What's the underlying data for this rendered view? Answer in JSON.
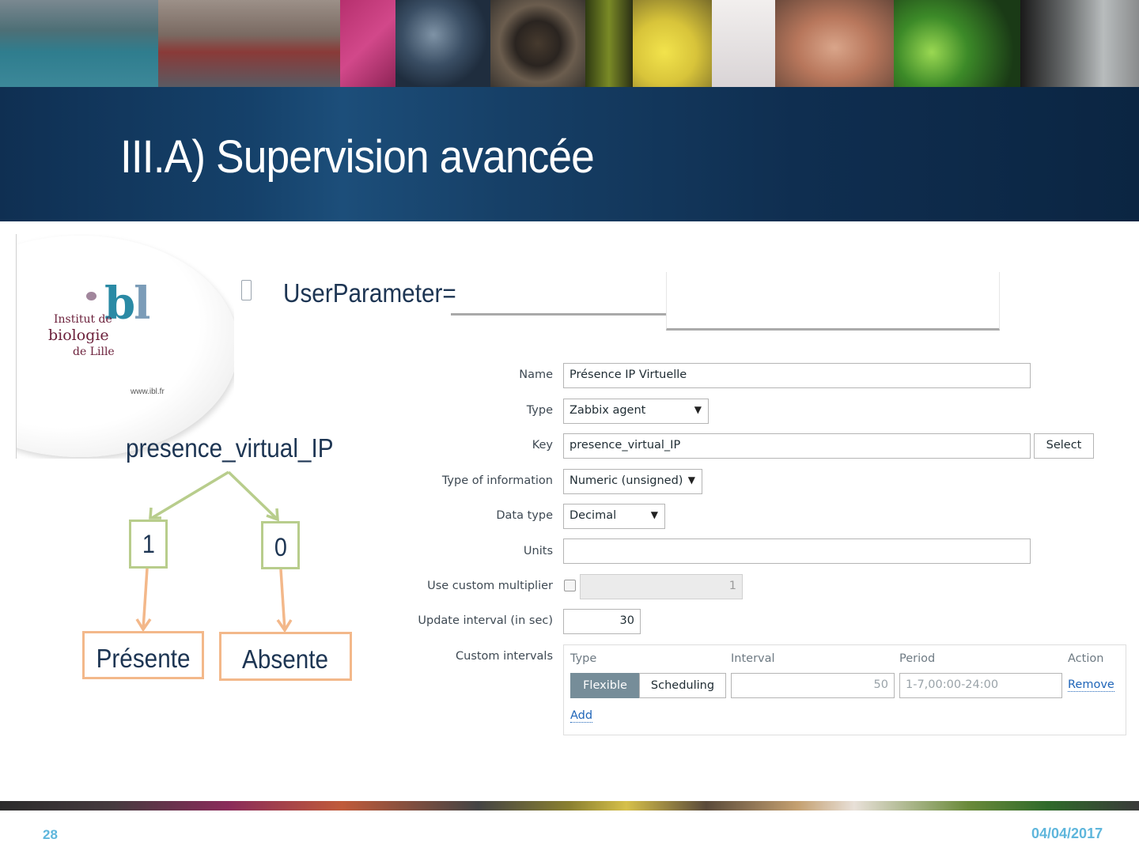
{
  "slide": {
    "title": "III.A) Supervision avancée",
    "page_number": "28",
    "date": "04/04/2017"
  },
  "logo": {
    "mark": "ibl",
    "line1": "Institut de",
    "line2": "biologie",
    "line3": "de Lille",
    "url": "www.ibl.fr"
  },
  "bullet": {
    "icon": "bullet-square-icon",
    "text": "UserParameter="
  },
  "tree": {
    "root": "presence_virtual_IP",
    "values": [
      "1",
      "0"
    ],
    "outcomes": [
      "Présente",
      "Absente"
    ],
    "colors": {
      "values_border": "#b8cd8c",
      "outcomes_border": "#f3b88a"
    }
  },
  "form": {
    "name": {
      "label": "Name",
      "value": "Présence IP Virtuelle"
    },
    "type": {
      "label": "Type",
      "value": "Zabbix agent"
    },
    "key": {
      "label": "Key",
      "value": "presence_virtual_IP",
      "button": "Select"
    },
    "type_of_information": {
      "label": "Type of information",
      "value": "Numeric (unsigned)"
    },
    "data_type": {
      "label": "Data type",
      "value": "Decimal"
    },
    "units": {
      "label": "Units",
      "value": ""
    },
    "custom_multiplier": {
      "label": "Use custom multiplier",
      "checked": false,
      "value": "1"
    },
    "update_interval": {
      "label": "Update interval (in sec)",
      "value": "30"
    },
    "custom_intervals": {
      "label": "Custom intervals",
      "headers": {
        "type": "Type",
        "interval": "Interval",
        "period": "Period",
        "action": "Action"
      },
      "row": {
        "type_options": [
          "Flexible",
          "Scheduling"
        ],
        "selected_type": "Flexible",
        "interval": "50",
        "period": "1-7,00:00-24:00",
        "action": "Remove"
      },
      "add_label": "Add"
    }
  },
  "colors": {
    "title_band": "#15416a",
    "text_dark": "#1d3553",
    "footer_text": "#5eb6dc",
    "segment_active": "#768d99",
    "link": "#1f65b8"
  }
}
